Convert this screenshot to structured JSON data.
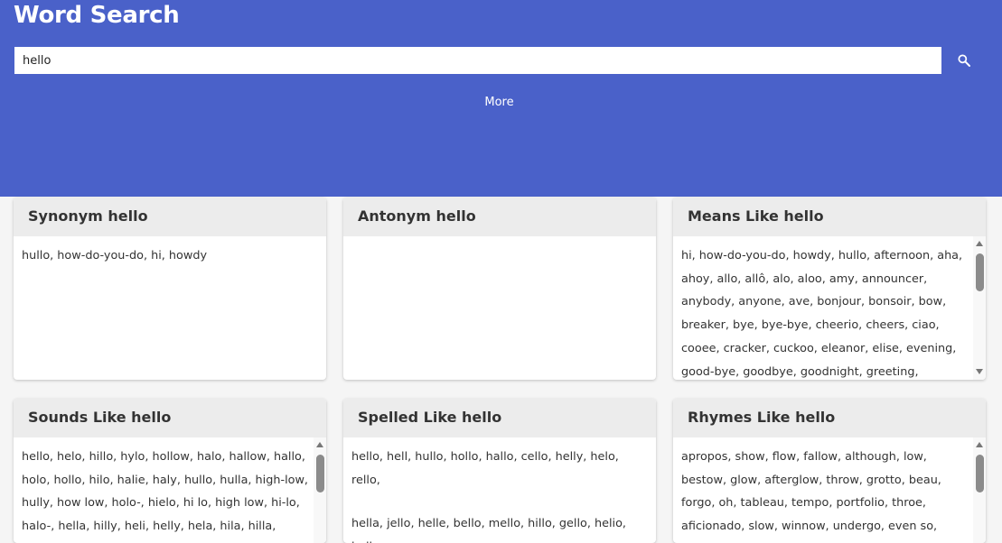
{
  "header": {
    "title": "Word Search",
    "search_value": "hello",
    "more_label": "More",
    "background": "#4a61c9"
  },
  "cards": {
    "synonym": {
      "title": "Synonym hello",
      "text": "hullo, how-do-you-do, hi, howdy"
    },
    "antonym": {
      "title": "Antonym hello",
      "text": ""
    },
    "means_like": {
      "title": "Means Like hello",
      "text": "hi, how-do-you-do, howdy, hullo, afternoon, aha, ahoy, allo, allô, alo, aloo, amy, announcer, anybody, anyone, ave, bonjour, bonsoir, bow, breaker, bye, bye-bye, cheerio, cheers, ciao, cooee, cracker, cuckoo, eleanor, elise, evening, good-bye, goodbye, goodnight, greeting,"
    },
    "sounds_like": {
      "title": "Sounds Like hello",
      "text": "hello, helo, hillo, hylo, hollow, halo, hallow, hallo, holo, hollo, hilo, halie, haly, hullo, hulla, high-low, hully, how low, holo-, hielo, hi lo, high low, hi-lo, halo-, hella, hilly, heli, helly, hela, hila, hilla, helie,"
    },
    "spelled_like": {
      "title": "Spelled Like hello",
      "text": "hello, hell, hullo, hollo, hallo, cello, helly, helo, rello,",
      "text2": "hella, jello, helle, bello, mello, hillo, gello, helio, hells,"
    },
    "rhymes_like": {
      "title": "Rhymes Like hello",
      "text": "apropos, show, flow, fallow, although, low, bestow, glow, afterglow, throw, grotto, beau, forgo, oh, tableau, tempo, portfolio, throe, aficionado, slow, winnow, undergo, even so,"
    }
  },
  "icons": {
    "search": "search-icon",
    "scroll_up": "scroll-up-arrow-icon",
    "scroll_down": "scroll-down-arrow-icon"
  }
}
